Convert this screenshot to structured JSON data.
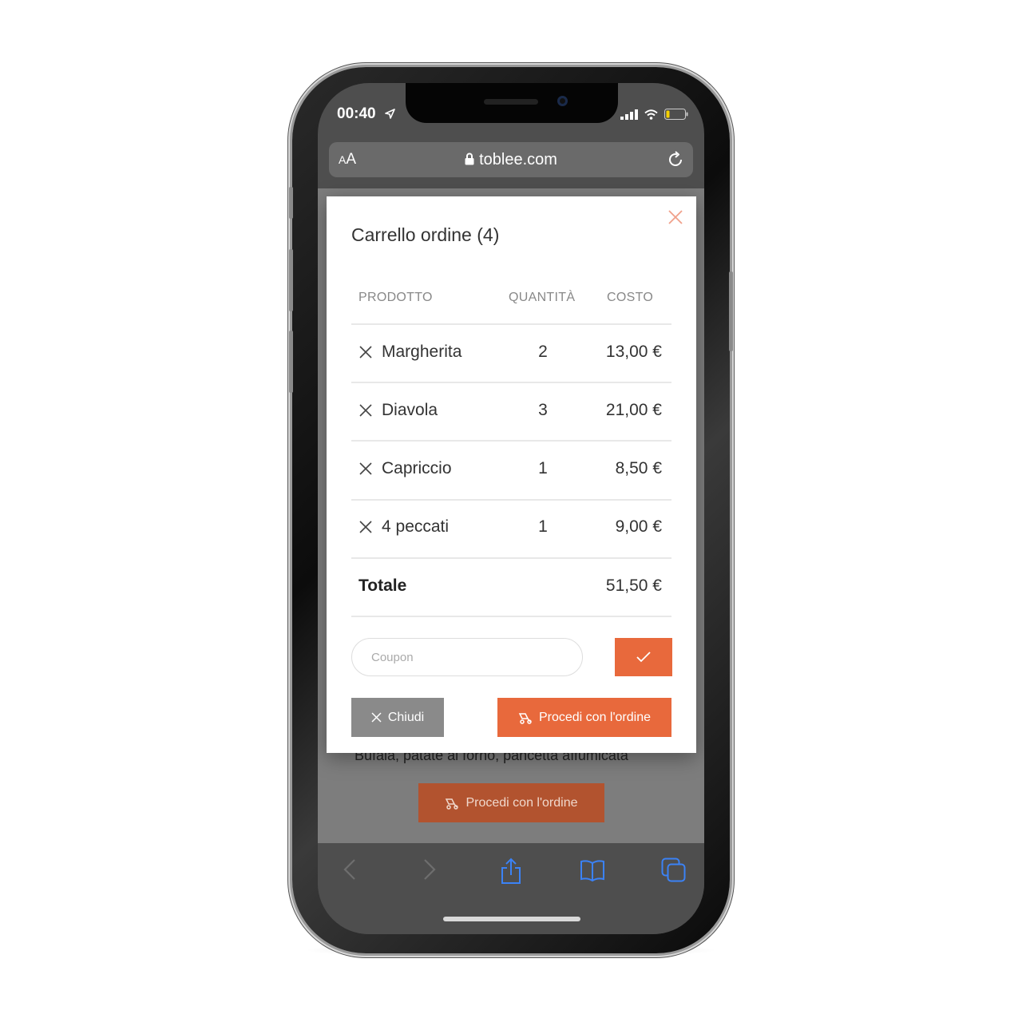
{
  "status_bar": {
    "time": "00:40"
  },
  "browser": {
    "text_size_label": "A",
    "text_size_label_large": "A",
    "url": "toblee.com"
  },
  "background_page": {
    "description_text": "Bufala, patate al forno, pancetta affumicata",
    "cta_label": "Procedi con l'ordine"
  },
  "cart_modal": {
    "title": "Carrello ordine (4)",
    "columns": {
      "product": "PRODOTTO",
      "quantity": "QUANTITÀ",
      "cost": "COSTO"
    },
    "items": [
      {
        "name": "Margherita",
        "quantity": "2",
        "cost": "13,00 €"
      },
      {
        "name": "Diavola",
        "quantity": "3",
        "cost": "21,00 €"
      },
      {
        "name": "Capriccio",
        "quantity": "1",
        "cost": "8,50 €"
      },
      {
        "name": "4 peccati",
        "quantity": "1",
        "cost": "9,00 €"
      }
    ],
    "total_label": "Totale",
    "total_value": "51,50 €",
    "coupon_placeholder": "Coupon",
    "close_label": "Chiudi",
    "proceed_label": "Procedi con l'ordine"
  },
  "colors": {
    "accent": "#e8693c",
    "secondary_button": "#8a8a8a",
    "toolbar_icon": "#3b82f6"
  }
}
